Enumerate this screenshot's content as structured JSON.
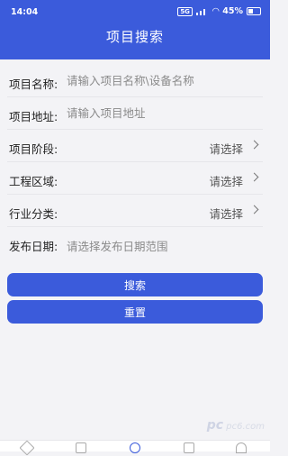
{
  "status_bar": {
    "time": "14:04",
    "battery_percent": "45%",
    "network_chip": "5G"
  },
  "header": {
    "title": "项目搜索"
  },
  "form": {
    "project_name": {
      "label": "项目名称:",
      "placeholder": "请输入项目名称\\设备名称"
    },
    "project_address": {
      "label": "项目地址:",
      "placeholder": "请输入项目地址"
    },
    "project_stage": {
      "label": "项目阶段:",
      "value": "请选择"
    },
    "engineering_region": {
      "label": "工程区域:",
      "value": "请选择"
    },
    "industry_category": {
      "label": "行业分类:",
      "value": "请选择"
    },
    "publish_date": {
      "label": "发布日期:",
      "placeholder": "请选择发布日期范围"
    }
  },
  "buttons": {
    "search": "搜索",
    "reset": "重置"
  },
  "watermark": {
    "text": "pc6.com",
    "brand": "pc"
  },
  "colors": {
    "primary": "#3b5bdb",
    "background": "#f3f3f6"
  },
  "icons": {
    "tabbar": [
      "home-icon",
      "doc-icon",
      "search-icon",
      "star-icon",
      "user-icon"
    ]
  }
}
